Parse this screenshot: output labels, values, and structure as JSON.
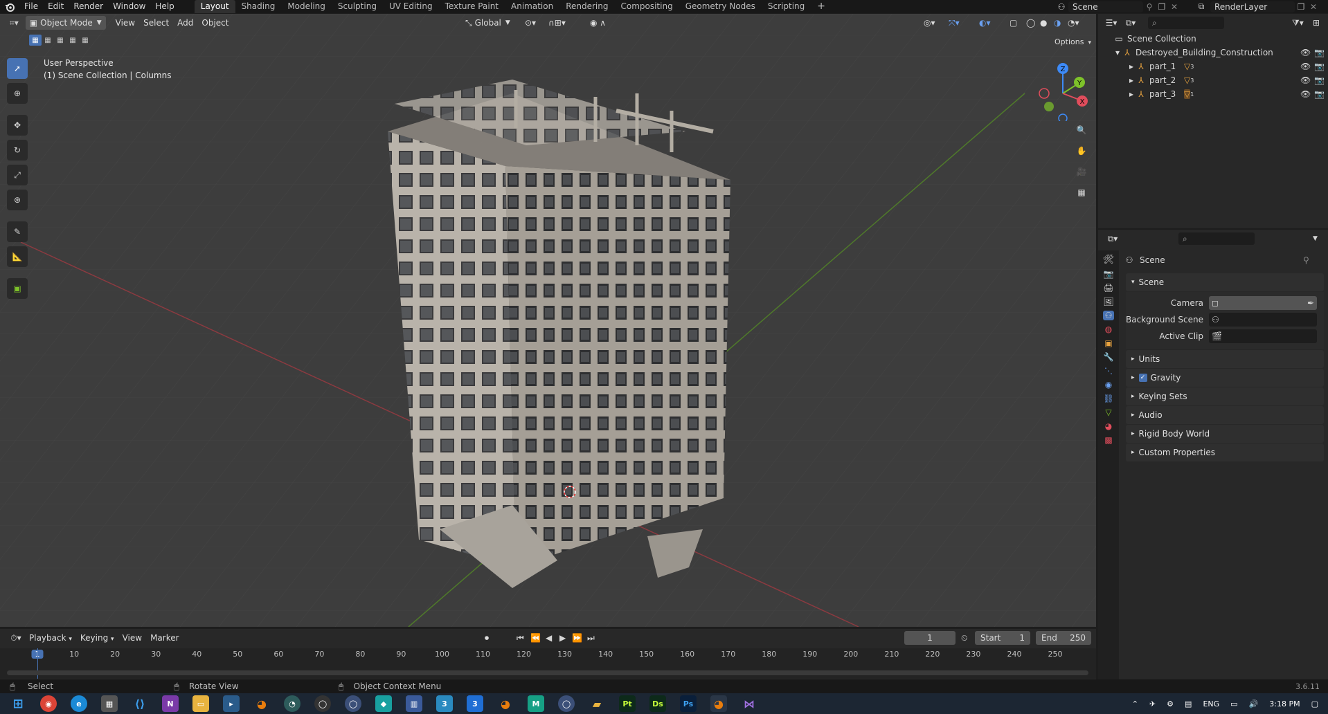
{
  "menubar": {
    "menus": [
      "File",
      "Edit",
      "Render",
      "Window",
      "Help"
    ],
    "workspaces": [
      "Layout",
      "Shading",
      "Modeling",
      "Sculpting",
      "UV Editing",
      "Texture Paint",
      "Animation",
      "Rendering",
      "Compositing",
      "Geometry Nodes",
      "Scripting"
    ],
    "active_workspace": "Layout",
    "scene_name": "Scene",
    "view_layer": "RenderLayer"
  },
  "viewport": {
    "mode": "Object Mode",
    "menus": [
      "View",
      "Select",
      "Add",
      "Object"
    ],
    "transform_orientation": "Global",
    "options_label": "Options",
    "overlay_title": "User Perspective",
    "overlay_subtitle": "(1) Scene Collection | Columns",
    "gizmo_axes": {
      "x": "X",
      "y": "Y",
      "z": "Z"
    }
  },
  "outliner": {
    "root": "Scene Collection",
    "collection": "Destroyed_Building_Construction",
    "children": [
      {
        "name": "part_1",
        "badge": "3"
      },
      {
        "name": "part_2",
        "badge": "3"
      },
      {
        "name": "part_3",
        "badge": "1"
      }
    ]
  },
  "properties": {
    "context_title": "Scene",
    "panel_scene": "Scene",
    "fields": {
      "camera_label": "Camera",
      "background_scene_label": "Background Scene",
      "active_clip_label": "Active Clip"
    },
    "panels": [
      "Units",
      "Gravity",
      "Keying Sets",
      "Audio",
      "Rigid Body World",
      "Custom Properties"
    ],
    "gravity_checked": true
  },
  "timeline": {
    "menus": [
      "Playback",
      "Keying",
      "View",
      "Marker"
    ],
    "current_frame": "1",
    "start_label": "Start",
    "start_value": "1",
    "end_label": "End",
    "end_value": "250",
    "ruler_ticks": [
      "1",
      "10",
      "20",
      "30",
      "40",
      "50",
      "60",
      "70",
      "80",
      "90",
      "100",
      "110",
      "120",
      "130",
      "140",
      "150",
      "160",
      "170",
      "180",
      "190",
      "200",
      "210",
      "220",
      "230",
      "240",
      "250"
    ]
  },
  "statusbar": {
    "select": "Select",
    "rotate": "Rotate View",
    "context": "Object Context Menu",
    "version": "3.6.11"
  },
  "taskbar": {
    "lang": "ENG",
    "time": "3:18 PM",
    "apps": [
      "Pt",
      "Ds",
      "Ps"
    ]
  },
  "colors": {
    "accent": "#4772b3",
    "axis_x": "#e14d5c",
    "axis_y": "#7ec22a",
    "axis_z": "#3d8af7"
  }
}
